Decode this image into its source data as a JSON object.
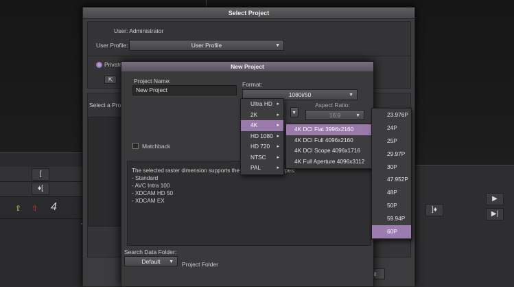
{
  "select_project": {
    "title": "Select Project",
    "user_label": "User: Administrator",
    "user_profile_label": "User Profile:",
    "user_profile_value": "User Profile",
    "private_label": "Private",
    "select_label": "Select a Project",
    "quit_label": "Quit"
  },
  "new_project": {
    "title": "New Project",
    "name_label": "Project Name:",
    "name_value": "New Project",
    "format_label": "Format:",
    "format_value": "1080i/50",
    "aspect_label": "Aspect Ratio:",
    "aspect_value": "16:9",
    "matchback_label": "Matchback",
    "info_text": [
      "The selected raster dimension supports the following raster types:",
      " - Standard",
      " - AVC Intra 100",
      " - XDCAM HD 50",
      " - XDCAM EX"
    ],
    "search_label": "Search Data Folder:",
    "search_value": "Default",
    "project_folder_label": "Project Folder"
  },
  "menu_formats": [
    "Ultra HD",
    "2K",
    "4K",
    "HD 1080",
    "HD 720",
    "NTSC",
    "PAL"
  ],
  "menu_4k": [
    "4K DCI Flat 3996x2160",
    "4K DCI Full 4096x2160",
    "4K DCI Scope 4096x1716",
    "4K Full Aperture 4096x3112"
  ],
  "menu_rates": [
    "23.976P",
    "24P",
    "25P",
    "29.97P",
    "30P",
    "47.952P",
    "48P",
    "50P",
    "59.94P",
    "60P"
  ],
  "colors": {
    "highlight": "#9a79ab",
    "title_bar": "#5a5060"
  }
}
